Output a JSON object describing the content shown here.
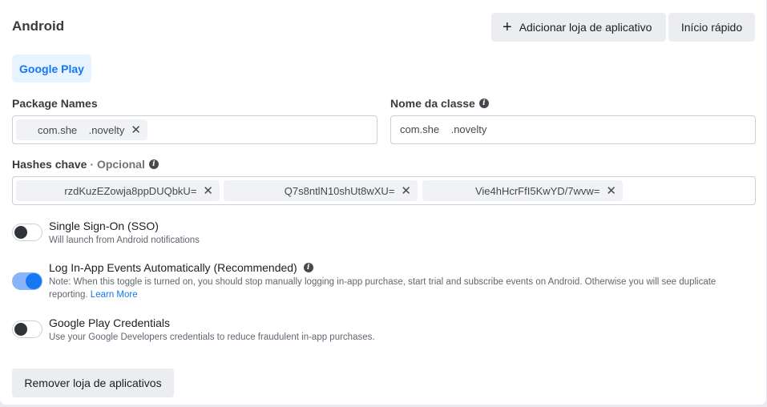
{
  "platform": {
    "title": "Android",
    "add_store_label": "Adicionar loja de aplicativo",
    "quick_start_label": "Início rápido",
    "store_tab_label": "Google Play"
  },
  "package_names": {
    "label": "Package Names",
    "chips": [
      "com.she    .novelty"
    ]
  },
  "class_name": {
    "label": "Nome da classe",
    "value": "com.she    .novelty"
  },
  "key_hashes": {
    "label": "Hashes chave",
    "optional": "· Opcional",
    "chips": [
      "rzdKuzEZowja8ppDUQbkU=",
      "Q7s8ntlN10shUt8wXU=",
      "Vie4hHcrFfI5KwYD/7wvw="
    ]
  },
  "options": [
    {
      "title": "Single Sign-On (SSO)",
      "desc": "Will launch from Android notifications",
      "enabled": false
    },
    {
      "title": "Log In-App Events Automatically (Recommended)",
      "desc": "Note: When this toggle is turned on, you should stop manually logging in-app purchase, start trial and subscribe events on Android. Otherwise you will see duplicate reporting.",
      "link": "Learn More",
      "enabled": true
    },
    {
      "title": "Google Play Credentials",
      "desc": "Use your Google Developers credentials to reduce fraudulent in-app purchases.",
      "enabled": false
    }
  ],
  "remove_store_label": "Remover loja de aplicativos",
  "icons": {
    "plus": "plus-icon",
    "close": "close-icon",
    "info": "info-icon"
  },
  "colors": {
    "accent": "#1877f2",
    "tab_bg": "#e7f3ff",
    "button_bg": "#ebedf0"
  }
}
